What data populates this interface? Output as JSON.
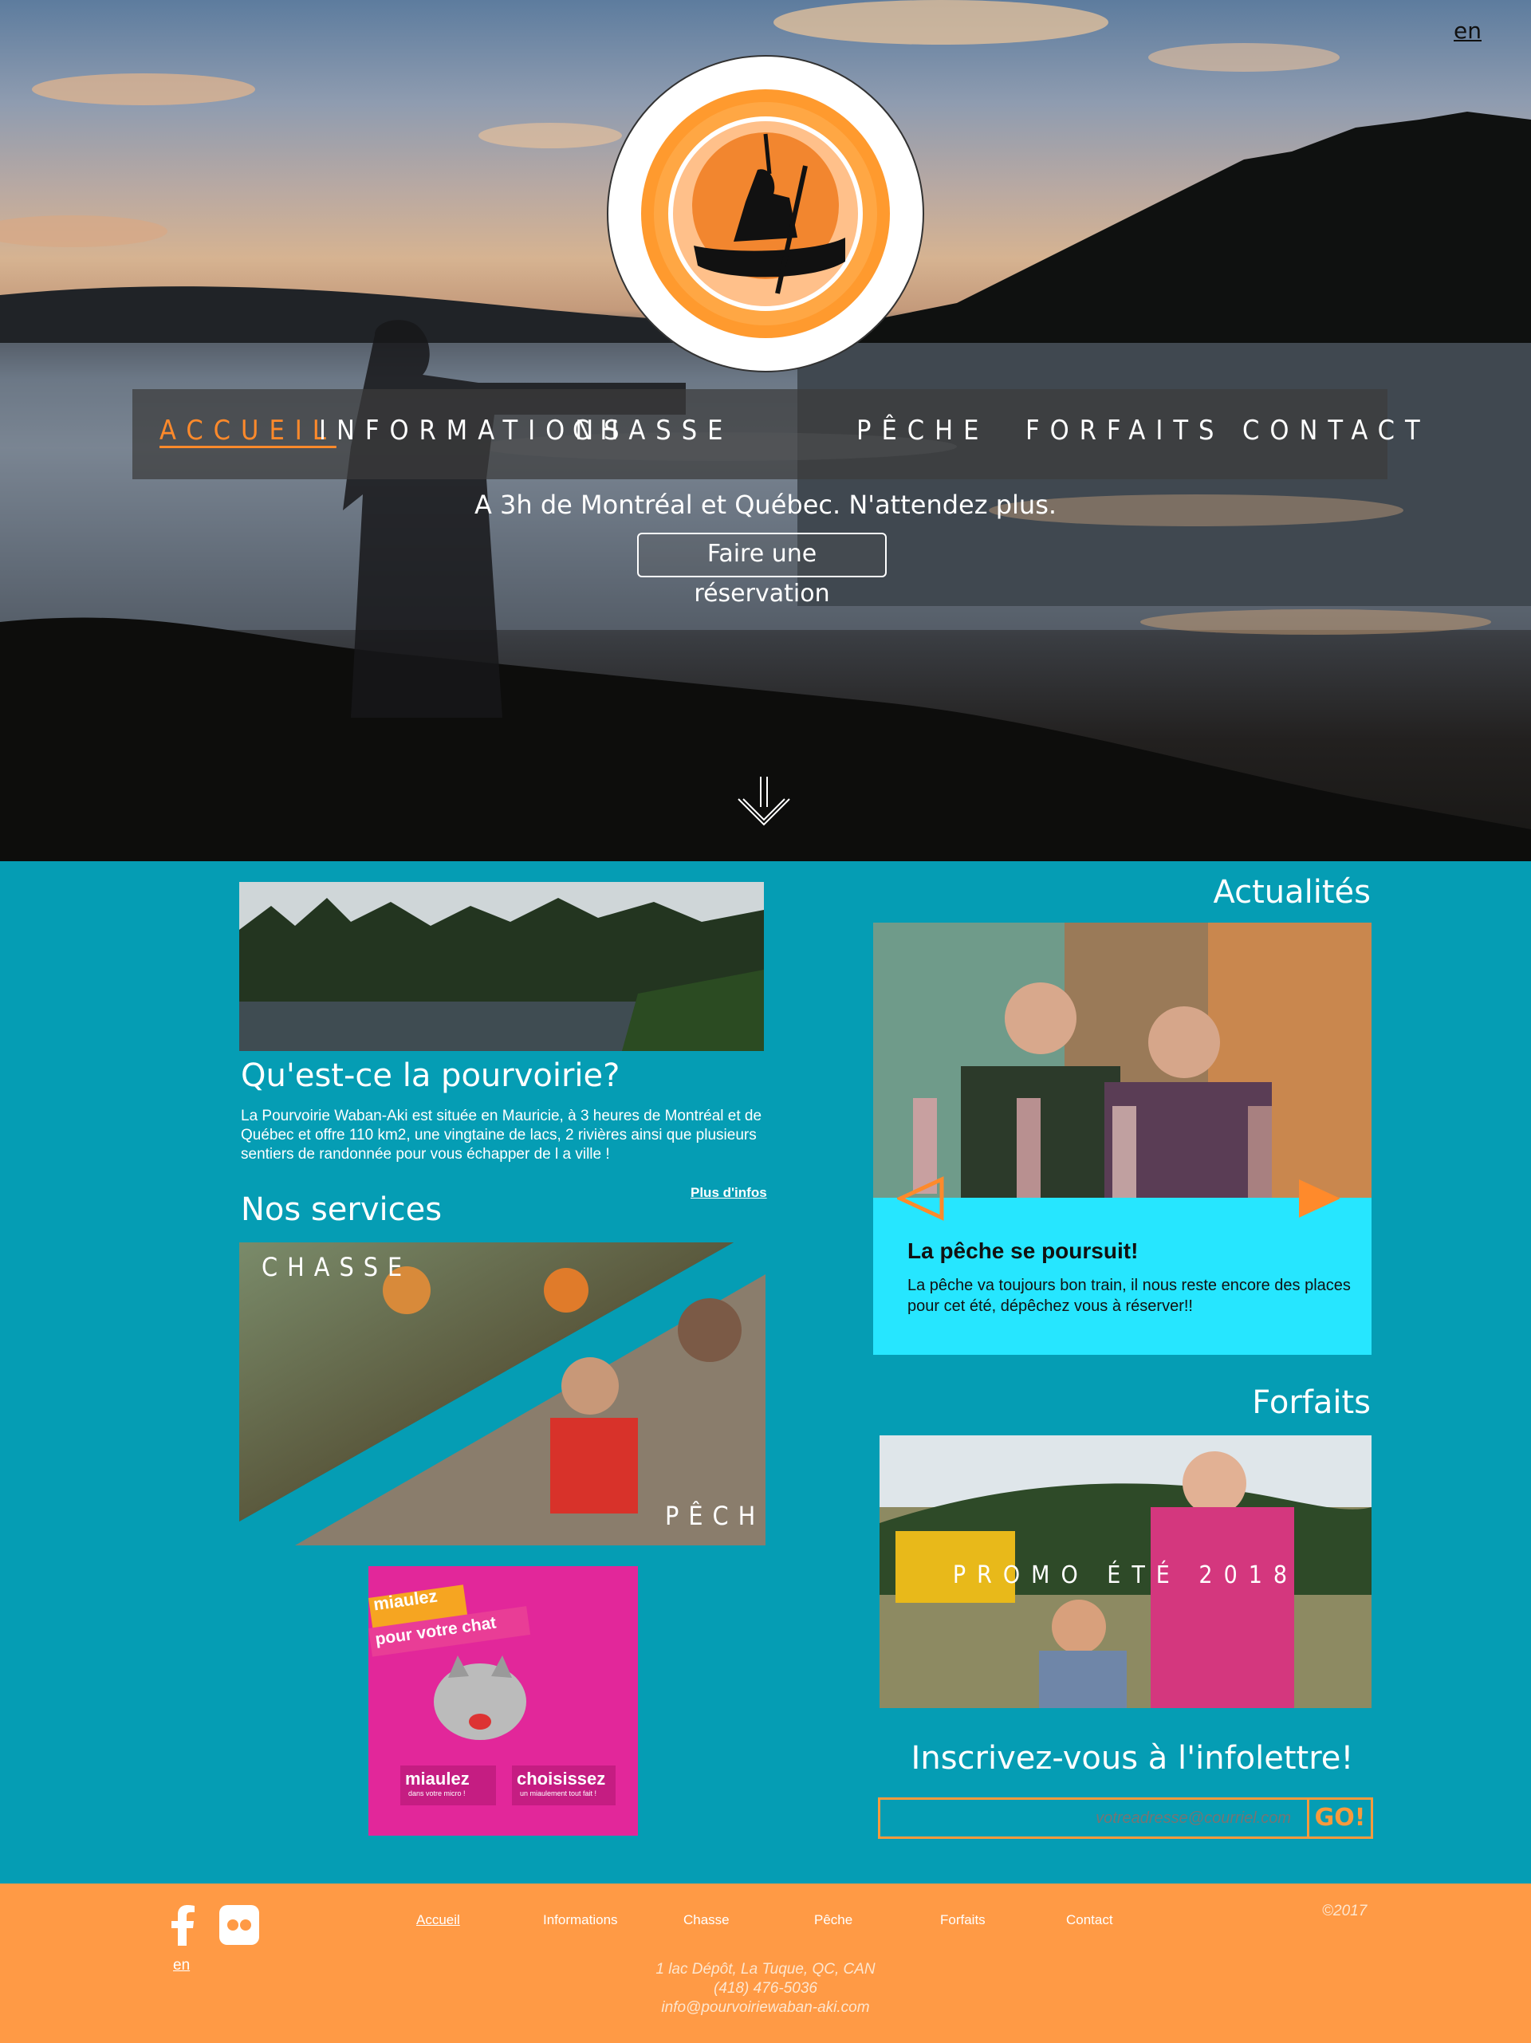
{
  "header": {
    "lang_switch": "en",
    "nav": [
      "Accueil",
      "Informations",
      "Chasse",
      "Pêche",
      "Forfaits",
      "Contact"
    ],
    "active_nav": "Accueil",
    "tagline": "A 3h de Montréal et Québec. N'attendez plus.",
    "reservation_button": "Faire une réservation"
  },
  "about": {
    "title": "Qu'est-ce la pourvoirie?",
    "text": "La Pourvoirie Waban-Aki est située en Mauricie, à 3 heures de Montréal et de Québec et offre 110 km2, une vingtaine de lacs, 2 rivières ainsi que plusieurs sentiers de randonnée pour vous échapper de l a ville !",
    "more_link": "Plus d'infos"
  },
  "services": {
    "title": "Nos services",
    "items": [
      "CHASSE",
      "PÊCHE"
    ]
  },
  "ad": {
    "line1": "miaulez",
    "line2": "pour votre chat",
    "left_big": "miaulez",
    "left_small": "dans votre micro !",
    "right_big": "choisissez",
    "right_small": "un miaulement tout fait !"
  },
  "news": {
    "title": "Actualités",
    "item_title": "La pêche se poursuit!",
    "item_text": "La pêche va toujours bon train, il nous reste encore des places pour cet été, dépêchez vous à réserver!!"
  },
  "forfaits": {
    "title": "Forfaits",
    "promo": "PROMO ÉTÉ 2018"
  },
  "newsletter": {
    "title": "Inscrivez-vous à l'infolettre!",
    "placeholder": "votreadresse@courriel.com",
    "button": "GO!"
  },
  "footer": {
    "lang": "en",
    "nav": [
      "Accueil",
      "Informations",
      "Chasse",
      "Pêche",
      "Forfaits",
      "Contact"
    ],
    "copyright": "©2017",
    "address": "1 lac Dépôt, La Tuque, QC, CAN",
    "phone": "(418) 476-5036",
    "email": "info@pourvoiriewaban-aki.com"
  },
  "colors": {
    "accent": "#ff8a2b",
    "teal": "#059db4",
    "cyan_card": "#26e6ff",
    "footer": "#ff9a45"
  },
  "icons": [
    "scroll-down-icon",
    "facebook-icon",
    "flickr-icon",
    "arrow-left-icon",
    "arrow-right-icon"
  ]
}
